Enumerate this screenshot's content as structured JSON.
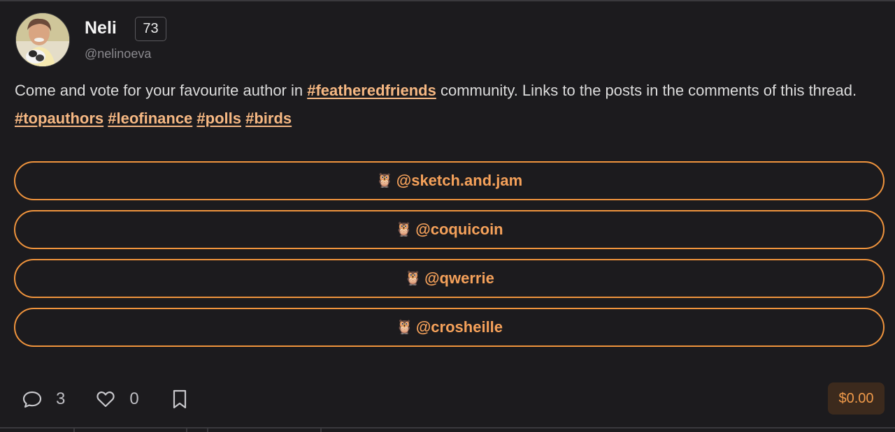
{
  "author": {
    "name": "Neli",
    "reputation": "73",
    "handle": "@nelinoeva"
  },
  "body": {
    "part1": "Come and vote for your favourite author in ",
    "tag1": "#featheredfriends",
    "part2": " community. Links to the posts in the comments of this thread. ",
    "tags": [
      "#topauthors",
      "#leofinance",
      "#polls",
      "#birds"
    ]
  },
  "poll": {
    "emoji": "🦉",
    "options": [
      {
        "label": "@sketch.and.jam"
      },
      {
        "label": "@coquicoin"
      },
      {
        "label": "@qwerrie"
      },
      {
        "label": "@crosheille"
      }
    ]
  },
  "actions": {
    "comments_icon": "comment-icon",
    "comments_count": "3",
    "likes_icon": "heart-icon",
    "likes_count": "0",
    "bookmark_icon": "bookmark-icon"
  },
  "payout": "$0.00",
  "colors": {
    "background": "#1c1b1e",
    "accent": "#f0943d",
    "tag": "#f6b883",
    "payout_bg": "#3c2a1d"
  }
}
